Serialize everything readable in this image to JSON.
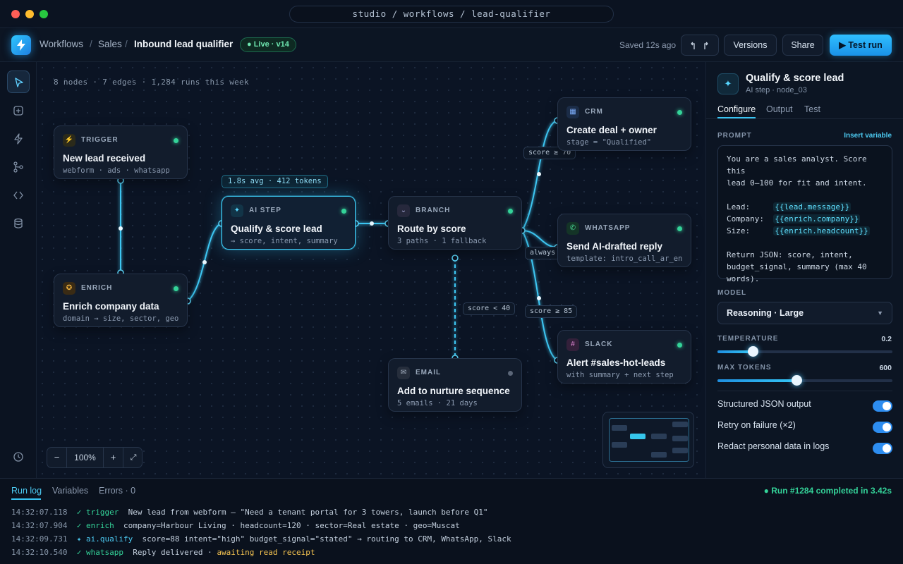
{
  "window": {
    "url": "studio / workflows / lead-qualifier"
  },
  "header": {
    "breadcrumb": [
      "Workflows",
      "Sales",
      "Inbound lead qualifier"
    ],
    "badge": "● Live · v14",
    "saved": "Saved 12s ago",
    "versions": "Versions",
    "share": "Share",
    "test_run": "▶ Test run"
  },
  "canvas": {
    "stats": "8 nodes · 7 edges · 1,284 runs this week",
    "ai_metric": "1.8s avg · 412 tokens",
    "zoom": "100%",
    "nodes": {
      "trigger": {
        "type": "TRIGGER",
        "title": "New lead received",
        "sub": "webform · ads · whatsapp"
      },
      "enrich": {
        "type": "ENRICH",
        "title": "Enrich company data",
        "sub": "domain → size, sector, geo"
      },
      "ai": {
        "type": "AI STEP",
        "title": "Qualify & score lead",
        "sub": "→ score, intent, summary"
      },
      "branch": {
        "type": "BRANCH",
        "title": "Route by score",
        "sub": "3 paths · 1 fallback"
      },
      "crm": {
        "type": "CRM",
        "title": "Create deal + owner",
        "sub": "stage = \"Qualified\""
      },
      "whatsapp": {
        "type": "WHATSAPP",
        "title": "Send AI-drafted reply",
        "sub": "template: intro_call_ar_en"
      },
      "slack": {
        "type": "SLACK",
        "title": "Alert #sales-hot-leads",
        "sub": "with summary + next step"
      },
      "email": {
        "type": "EMAIL",
        "title": "Add to nurture sequence",
        "sub": "5 emails · 21 days"
      }
    },
    "edge_labels": {
      "score70": "score ≥ 70",
      "always": "always",
      "score85": "score ≥ 85",
      "score40": "score < 40"
    }
  },
  "inspector": {
    "title": "Qualify & score lead",
    "subtitle": "AI step · node_03",
    "tabs": [
      "Configure",
      "Output",
      "Test"
    ],
    "prompt_label": "PROMPT",
    "insert_variable": "Insert variable",
    "prompt_intro": "You are a sales analyst. Score this\nlead 0–100 for fit and intent.",
    "prompt_vars": [
      {
        "label": "Lead:     ",
        "var": "{{lead.message}}"
      },
      {
        "label": "Company:  ",
        "var": "{{enrich.company}}"
      },
      {
        "label": "Size:     ",
        "var": "{{enrich.headcount}}"
      }
    ],
    "prompt_outro": "Return JSON: score, intent,\nbudget_signal, summary (max 40\nwords).",
    "model_label": "MODEL",
    "model": "Reasoning · Large",
    "temperature_label": "TEMPERATURE",
    "temperature": "0.2",
    "temperature_frac": 0.2,
    "max_tokens_label": "MAX TOKENS",
    "max_tokens": "600",
    "max_tokens_frac": 0.45,
    "toggles": [
      {
        "label": "Structured JSON output",
        "on": true
      },
      {
        "label": "Retry on failure (×2)",
        "on": true
      },
      {
        "label": "Redact personal data in logs",
        "on": true
      }
    ]
  },
  "runlog": {
    "tabs": [
      "Run log",
      "Variables",
      "Errors · 0"
    ],
    "status": "● Run #1284 completed in 3.42s",
    "lines": [
      {
        "time": "14:32:07.118",
        "step": "✓ trigger",
        "msg": "New lead from webform — \"Need a tenant portal for 3 towers, launch before Q1\"",
        "warn": ""
      },
      {
        "time": "14:32:07.904",
        "step": "✓ enrich",
        "msg": "company=Harbour Living · headcount=120 · sector=Real estate · geo=Muscat",
        "warn": ""
      },
      {
        "time": "14:32:09.731",
        "step": "✦ ai.qualify",
        "msg": "score=88 intent=\"high\" budget_signal=\"stated\" → routing to CRM, WhatsApp, Slack",
        "warn": ""
      },
      {
        "time": "14:32:10.540",
        "step": "✓ whatsapp",
        "msg": "Reply delivered · ",
        "warn": "awaiting read receipt"
      }
    ]
  },
  "colors": {
    "accent": "#35c6f5",
    "success": "#34d399",
    "warning": "#f5c451",
    "background": "#0a1220"
  }
}
